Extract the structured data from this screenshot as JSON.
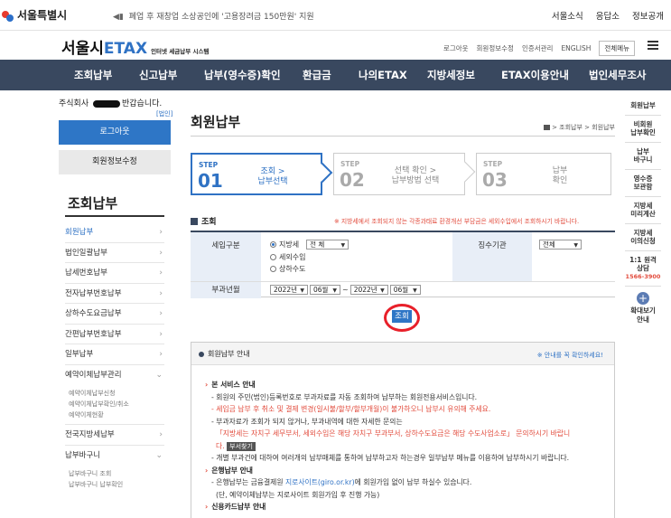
{
  "topbar": {
    "logo": "서울특별시",
    "notice": "폐업 후 재창업 소상공인에 '고용장려금 150만원' 지원",
    "links": [
      "서울소식",
      "응답소",
      "정보공개"
    ]
  },
  "logo_row": {
    "brand_black": "서울시",
    "brand_blue": "ETAX",
    "brand_sub": "인터넷 세금납부 시스템",
    "links": [
      "로그아웃",
      "회원정보수정",
      "인증서관리",
      "ENGLISH"
    ],
    "all_menu": "전체메뉴"
  },
  "nav": [
    "조회납부",
    "신고납부",
    "납부(영수증)확인",
    "환급금",
    "나의ETAX",
    "지방세정보",
    "ETAX이용안내",
    "법인세무조사"
  ],
  "sidebar": {
    "welcome_prefix": "주식회사",
    "welcome_suffix": "반갑습니다.",
    "tag": "[법인]",
    "logout": "로그아웃",
    "member_edit": "회원정보수정",
    "title": "조회납부",
    "items": [
      "회원납부",
      "법인일괄납부",
      "납세번호납부",
      "전자납부번호납부",
      "상하수도요금납부",
      "간편납부번호납부",
      "일부납부",
      "예약이체납부관리"
    ],
    "sub1": [
      "예약이체납부신청",
      "예약이체납부확인/취소",
      "예약이체현황"
    ],
    "items2": [
      "전국지방세납부",
      "납부바구니"
    ],
    "sub2": [
      "납부바구니 조회",
      "납부바구니 납부확인"
    ]
  },
  "content": {
    "title": "회원납부",
    "breadcrumb": "> 조회납부 > 회원납부",
    "steps": [
      {
        "label": "STEP",
        "num": "01",
        "desc1": "조회 >",
        "desc2": "납부선택"
      },
      {
        "label": "STEP",
        "num": "02",
        "desc1": "선택 확인 >",
        "desc2": "납부방법 선택"
      },
      {
        "label": "STEP",
        "num": "03",
        "desc1": "납부",
        "desc2": "확인"
      }
    ],
    "section": "조회",
    "section_note": "※ 지방세에서 조회되지 않는 각종과태료 환경개선 부담금은 세외수입에서 조회하시기 바랍니다.",
    "form": {
      "tax_type_label": "세입구분",
      "radio_local": "지방세",
      "radio_local_select": "전 체",
      "radio_nontax": "세외수입",
      "radio_water": "상하수도",
      "agency_label": "징수기관",
      "agency_select": "전체",
      "period_label": "부과년월",
      "from_year": "2022년",
      "from_month": "06월",
      "dash": "~",
      "to_year": "2022년",
      "to_month": "06월"
    },
    "query_button": "조회",
    "info": {
      "head": "회원납부 안내",
      "head_right": "※ 안내를 꼭 확인하세요!",
      "h1": "본 서비스 안내",
      "l1": "- 회원의 주민(법인)등록번호로 부과자료를 자동 조회하여 납부하는 회원전용서비스입니다.",
      "l2": "- 세입금 납부 후 취소 및 결제 변경(일시불/할부/할부개월)이 불가하오니 납부시 유의해 주세요.",
      "l3": "- 부과자료가 조회가 되지 않거나, 부과내역에 대한 자세한 문의는",
      "l4": "「지방세는 자치구 세무부서, 세외수입은 해당 자치구 부과부서, 상하수도요금은 해당 수도사업소로」 문의하시기 바랍니",
      "l5": "다.",
      "find_btn": "부서찾기",
      "l6": "- 개별 부과건에 대하여 여러개의 납부매체를 통하여 납부하고자 하는경우 일부납부 메뉴를 이용하여 납부하시기 바랍니다.",
      "h2": "은행납부 안내",
      "l7a": "- 은행납부는 금융결제원",
      "l7b": "지로사이트(giro.or.kr)",
      "l7c": "에 회원가입 없이 납부 하실수 있습니다.",
      "l8": "(단, 예약이체납부는 지로사이트 회원가입 후 진행 가능)",
      "h3": "신용카드납부 안내"
    }
  },
  "quick": {
    "items": [
      "회원납부",
      "비회원\n납부확인",
      "납부\n바구니",
      "영수증\n보관함",
      "지방세\n미리계산",
      "지방세\n이의신청",
      "1:1 원격\n상담"
    ],
    "phone": "1566-3900",
    "more": "확대보기\n안내"
  }
}
